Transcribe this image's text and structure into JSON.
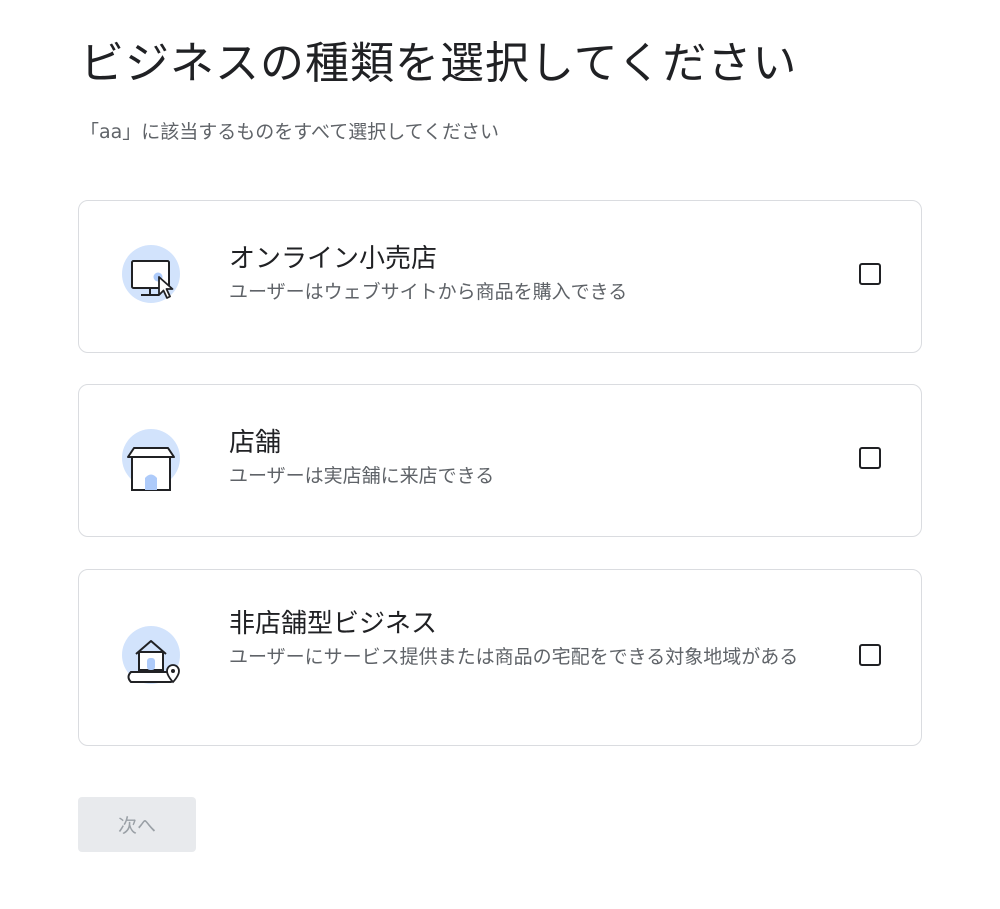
{
  "header": {
    "title": "ビジネスの種類を選択してください",
    "subtitle": "「aa」に該当するものをすべて選択してください"
  },
  "options": [
    {
      "title": "オンライン小売店",
      "description": "ユーザーはウェブサイトから商品を購入できる",
      "icon": "monitor-cursor-icon",
      "checked": false
    },
    {
      "title": "店舗",
      "description": "ユーザーは実店舗に来店できる",
      "icon": "storefront-icon",
      "checked": false
    },
    {
      "title": "非店舗型ビジネス",
      "description": "ユーザーにサービス提供または商品の宅配をできる対象地域がある",
      "icon": "house-map-pin-icon",
      "checked": false
    }
  ],
  "footer": {
    "next_label": "次へ"
  },
  "colors": {
    "icon_circle": "#d2e3fc",
    "icon_accent": "#aecbfa",
    "card_border": "#dadce0",
    "button_disabled_bg": "#e8eaed",
    "button_disabled_text": "#9aa0a6"
  }
}
